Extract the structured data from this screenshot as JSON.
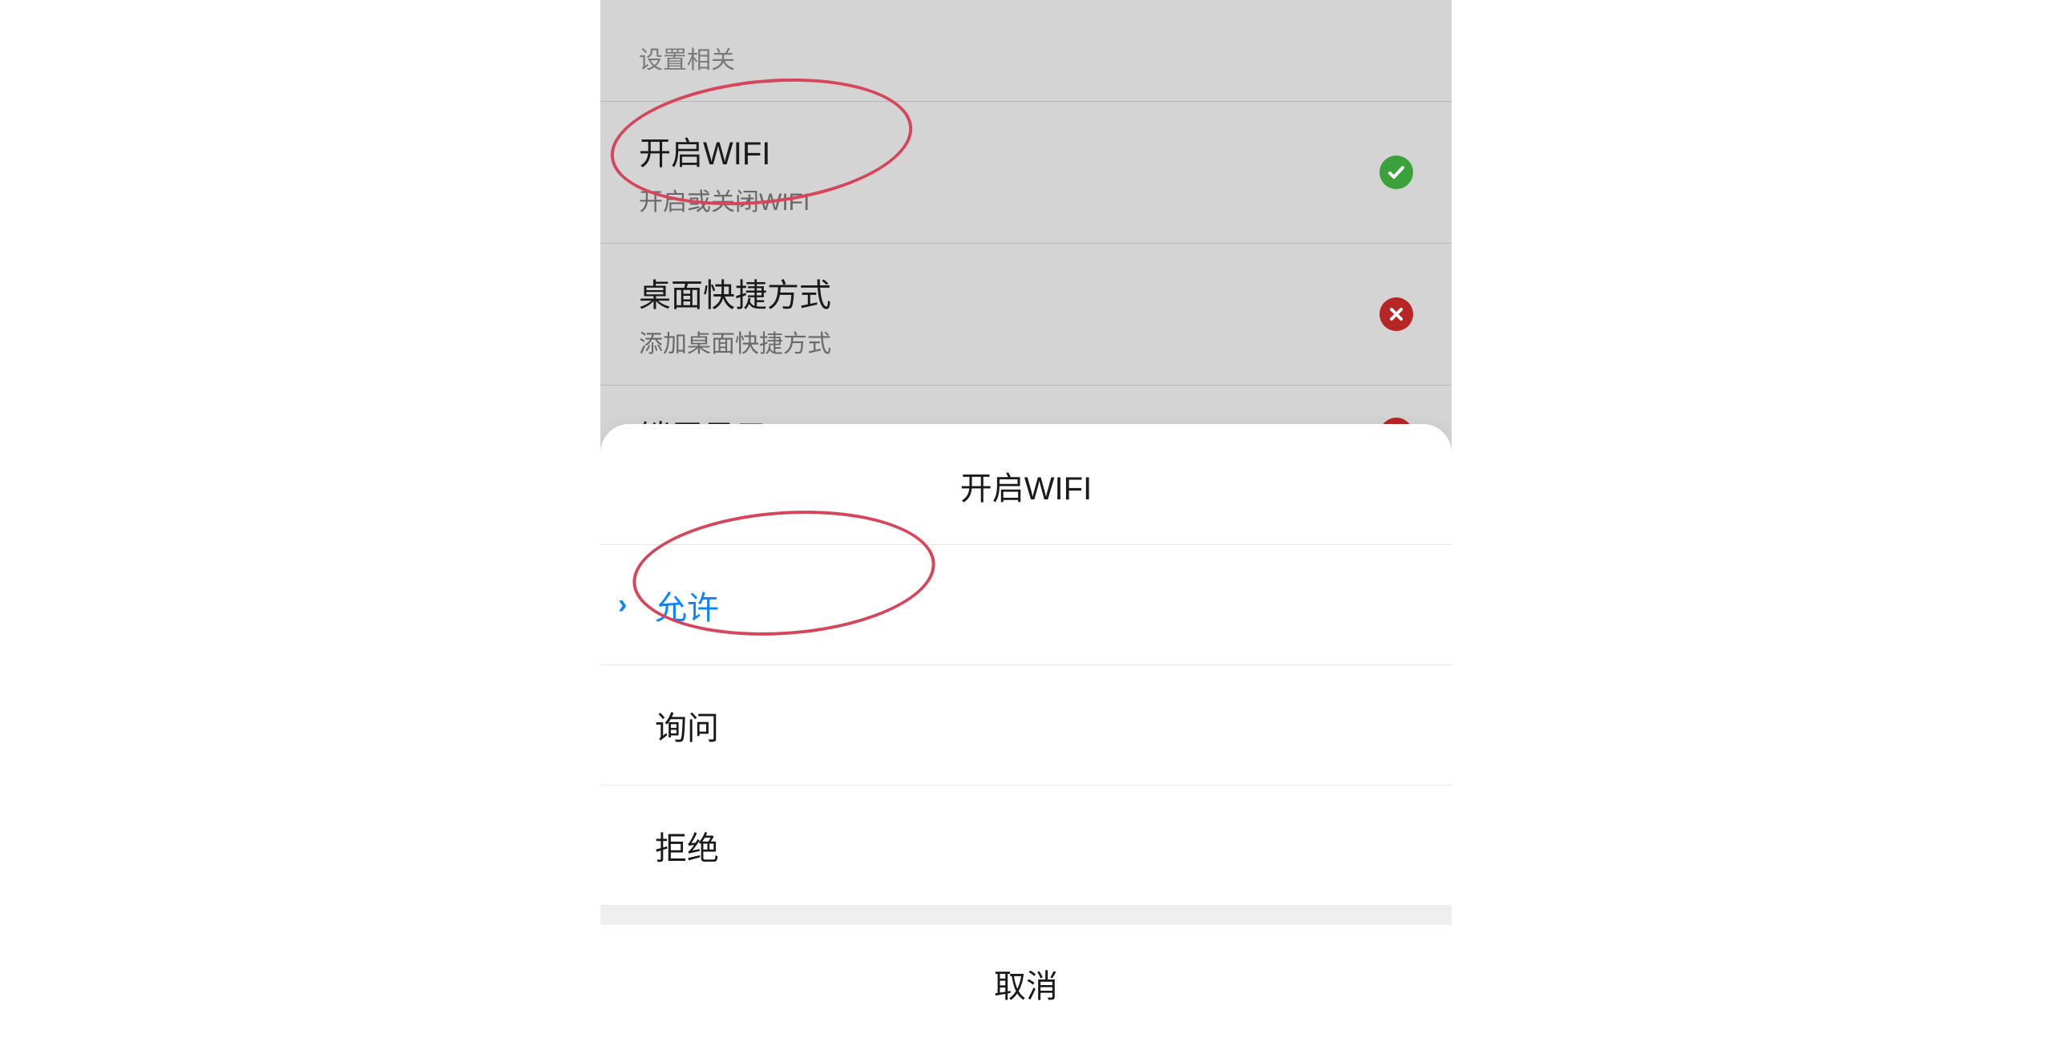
{
  "settings": {
    "section_header": "设置相关",
    "rows": [
      {
        "title": "开启WIFI",
        "subtitle": "开启或关闭WIFI",
        "status": "allowed"
      },
      {
        "title": "桌面快捷方式",
        "subtitle": "添加桌面快捷方式",
        "status": "denied"
      },
      {
        "title": "锁屏显示",
        "subtitle": "",
        "status": "denied"
      }
    ]
  },
  "action_sheet": {
    "title": "开启WIFI",
    "options": [
      {
        "label": "允许",
        "selected": true
      },
      {
        "label": "询问",
        "selected": false
      },
      {
        "label": "拒绝",
        "selected": false
      }
    ],
    "cancel_label": "取消"
  },
  "colors": {
    "allowed_badge": "#3ba23b",
    "denied_badge": "#b82525",
    "accent_blue": "#0b84ff",
    "annotation_stroke": "#d6455a"
  }
}
